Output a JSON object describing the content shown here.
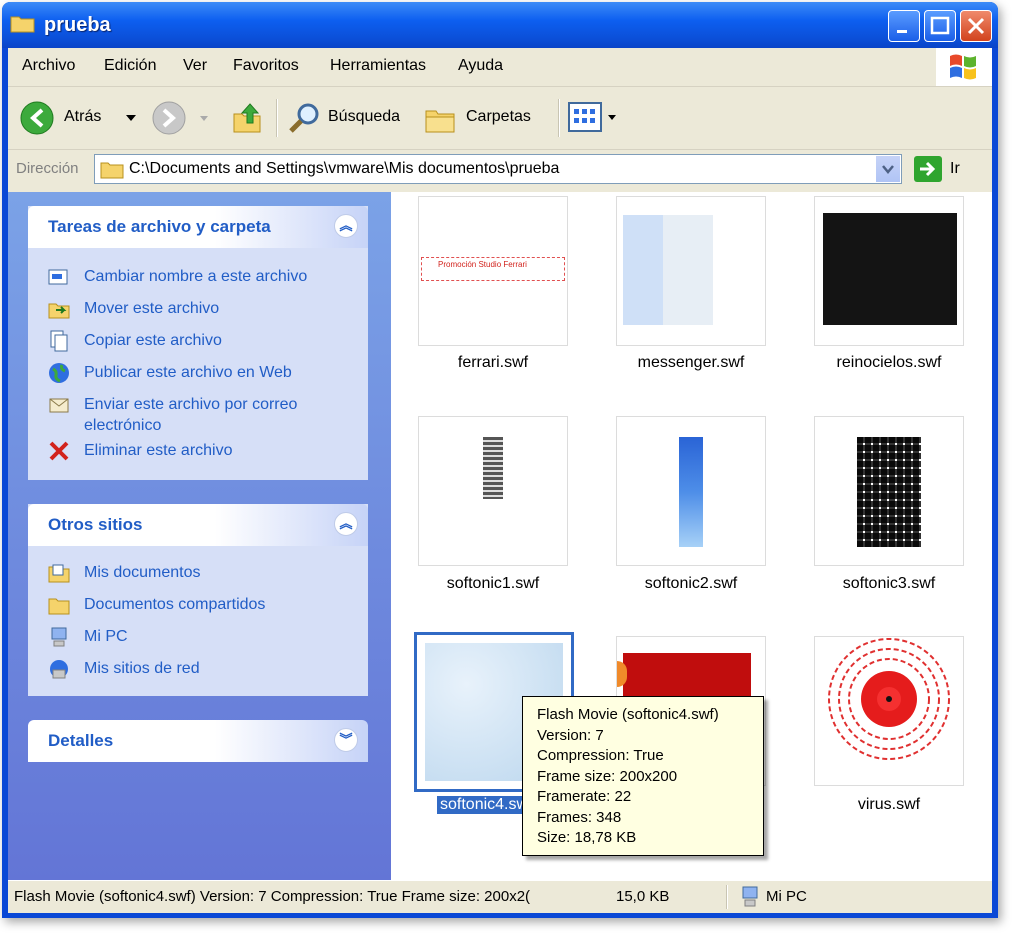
{
  "window": {
    "title": "prueba"
  },
  "menu": [
    "Archivo",
    "Edición",
    "Ver",
    "Favoritos",
    "Herramientas",
    "Ayuda"
  ],
  "toolbar": {
    "back_label": "Atrás",
    "search_label": "Búsqueda",
    "folders_label": "Carpetas"
  },
  "address": {
    "label": "Dirección",
    "path": "C:\\Documents and Settings\\vmware\\Mis documentos\\prueba",
    "go_label": "Ir"
  },
  "tasks_panel": {
    "title": "Tareas de archivo y carpeta",
    "items": [
      "Cambiar nombre a este archivo",
      "Mover este archivo",
      "Copiar este archivo",
      "Publicar este archivo en Web",
      "Enviar este archivo por correo electrónico",
      "Eliminar este archivo"
    ]
  },
  "places_panel": {
    "title": "Otros sitios",
    "items": [
      "Mis documentos",
      "Documentos compartidos",
      "Mi PC",
      "Mis sitios de red"
    ]
  },
  "details_panel": {
    "title": "Detalles"
  },
  "files": [
    {
      "name": "ferrari.swf",
      "caption": "Promoción Studio Ferrari"
    },
    {
      "name": "messenger.swf"
    },
    {
      "name": "reinocielos.swf"
    },
    {
      "name": "softonic1.swf"
    },
    {
      "name": "softonic2.swf"
    },
    {
      "name": "softonic3.swf"
    },
    {
      "name": "softonic4.sw",
      "selected": true
    },
    {
      "name": ""
    },
    {
      "name": "virus.swf"
    }
  ],
  "tooltip": [
    "Flash Movie (softonic4.swf)",
    "Version: 7",
    "Compression: True",
    "Frame size: 200x200",
    "Framerate: 22",
    "Frames: 348",
    "Size: 18,78 KB"
  ],
  "status": {
    "text": "Flash Movie (softonic4.swf) Version: 7 Compression: True Frame size: 200x2(",
    "size": "15,0 KB",
    "zone": "Mi PC"
  },
  "colors": {
    "titlebar": "#0b4fd8",
    "sidebar": "#7ba2e7",
    "link": "#215dc6",
    "selection": "#316ac5",
    "tooltip_bg": "#ffffe1"
  }
}
